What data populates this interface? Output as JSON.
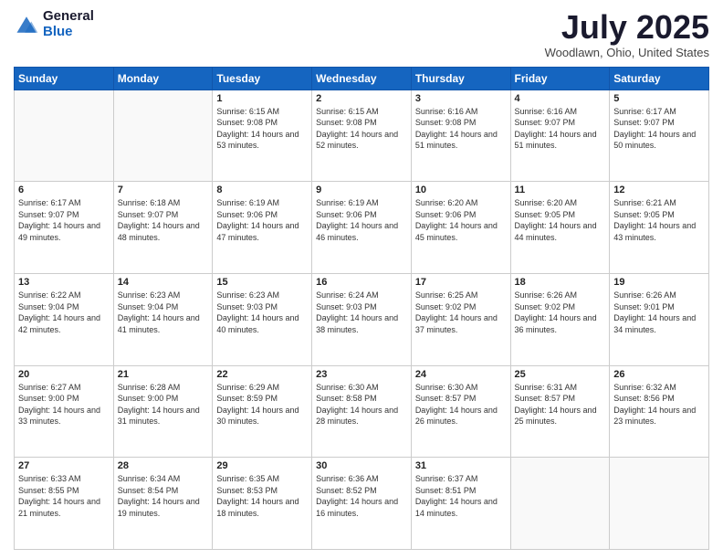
{
  "header": {
    "logo_general": "General",
    "logo_blue": "Blue",
    "month_title": "July 2025",
    "location": "Woodlawn, Ohio, United States"
  },
  "days_of_week": [
    "Sunday",
    "Monday",
    "Tuesday",
    "Wednesday",
    "Thursday",
    "Friday",
    "Saturday"
  ],
  "weeks": [
    [
      {
        "day": "",
        "empty": true
      },
      {
        "day": "",
        "empty": true
      },
      {
        "day": "1",
        "sunrise": "6:15 AM",
        "sunset": "9:08 PM",
        "daylight": "14 hours and 53 minutes."
      },
      {
        "day": "2",
        "sunrise": "6:15 AM",
        "sunset": "9:08 PM",
        "daylight": "14 hours and 52 minutes."
      },
      {
        "day": "3",
        "sunrise": "6:16 AM",
        "sunset": "9:08 PM",
        "daylight": "14 hours and 51 minutes."
      },
      {
        "day": "4",
        "sunrise": "6:16 AM",
        "sunset": "9:07 PM",
        "daylight": "14 hours and 51 minutes."
      },
      {
        "day": "5",
        "sunrise": "6:17 AM",
        "sunset": "9:07 PM",
        "daylight": "14 hours and 50 minutes."
      }
    ],
    [
      {
        "day": "6",
        "sunrise": "6:17 AM",
        "sunset": "9:07 PM",
        "daylight": "14 hours and 49 minutes."
      },
      {
        "day": "7",
        "sunrise": "6:18 AM",
        "sunset": "9:07 PM",
        "daylight": "14 hours and 48 minutes."
      },
      {
        "day": "8",
        "sunrise": "6:19 AM",
        "sunset": "9:06 PM",
        "daylight": "14 hours and 47 minutes."
      },
      {
        "day": "9",
        "sunrise": "6:19 AM",
        "sunset": "9:06 PM",
        "daylight": "14 hours and 46 minutes."
      },
      {
        "day": "10",
        "sunrise": "6:20 AM",
        "sunset": "9:06 PM",
        "daylight": "14 hours and 45 minutes."
      },
      {
        "day": "11",
        "sunrise": "6:20 AM",
        "sunset": "9:05 PM",
        "daylight": "14 hours and 44 minutes."
      },
      {
        "day": "12",
        "sunrise": "6:21 AM",
        "sunset": "9:05 PM",
        "daylight": "14 hours and 43 minutes."
      }
    ],
    [
      {
        "day": "13",
        "sunrise": "6:22 AM",
        "sunset": "9:04 PM",
        "daylight": "14 hours and 42 minutes."
      },
      {
        "day": "14",
        "sunrise": "6:23 AM",
        "sunset": "9:04 PM",
        "daylight": "14 hours and 41 minutes."
      },
      {
        "day": "15",
        "sunrise": "6:23 AM",
        "sunset": "9:03 PM",
        "daylight": "14 hours and 40 minutes."
      },
      {
        "day": "16",
        "sunrise": "6:24 AM",
        "sunset": "9:03 PM",
        "daylight": "14 hours and 38 minutes."
      },
      {
        "day": "17",
        "sunrise": "6:25 AM",
        "sunset": "9:02 PM",
        "daylight": "14 hours and 37 minutes."
      },
      {
        "day": "18",
        "sunrise": "6:26 AM",
        "sunset": "9:02 PM",
        "daylight": "14 hours and 36 minutes."
      },
      {
        "day": "19",
        "sunrise": "6:26 AM",
        "sunset": "9:01 PM",
        "daylight": "14 hours and 34 minutes."
      }
    ],
    [
      {
        "day": "20",
        "sunrise": "6:27 AM",
        "sunset": "9:00 PM",
        "daylight": "14 hours and 33 minutes."
      },
      {
        "day": "21",
        "sunrise": "6:28 AM",
        "sunset": "9:00 PM",
        "daylight": "14 hours and 31 minutes."
      },
      {
        "day": "22",
        "sunrise": "6:29 AM",
        "sunset": "8:59 PM",
        "daylight": "14 hours and 30 minutes."
      },
      {
        "day": "23",
        "sunrise": "6:30 AM",
        "sunset": "8:58 PM",
        "daylight": "14 hours and 28 minutes."
      },
      {
        "day": "24",
        "sunrise": "6:30 AM",
        "sunset": "8:57 PM",
        "daylight": "14 hours and 26 minutes."
      },
      {
        "day": "25",
        "sunrise": "6:31 AM",
        "sunset": "8:57 PM",
        "daylight": "14 hours and 25 minutes."
      },
      {
        "day": "26",
        "sunrise": "6:32 AM",
        "sunset": "8:56 PM",
        "daylight": "14 hours and 23 minutes."
      }
    ],
    [
      {
        "day": "27",
        "sunrise": "6:33 AM",
        "sunset": "8:55 PM",
        "daylight": "14 hours and 21 minutes."
      },
      {
        "day": "28",
        "sunrise": "6:34 AM",
        "sunset": "8:54 PM",
        "daylight": "14 hours and 19 minutes."
      },
      {
        "day": "29",
        "sunrise": "6:35 AM",
        "sunset": "8:53 PM",
        "daylight": "14 hours and 18 minutes."
      },
      {
        "day": "30",
        "sunrise": "6:36 AM",
        "sunset": "8:52 PM",
        "daylight": "14 hours and 16 minutes."
      },
      {
        "day": "31",
        "sunrise": "6:37 AM",
        "sunset": "8:51 PM",
        "daylight": "14 hours and 14 minutes."
      },
      {
        "day": "",
        "empty": true
      },
      {
        "day": "",
        "empty": true
      }
    ]
  ]
}
